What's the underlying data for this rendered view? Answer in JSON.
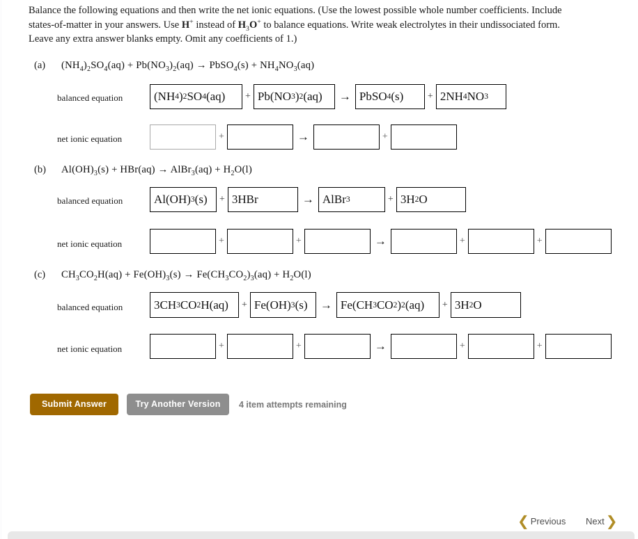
{
  "instructions": {
    "line1_a": "Balance the following equations and then write the net ionic equations. (Use the lowest possible whole number coefficients. Include",
    "line2_a": "states-of-matter in your answers. Use ",
    "line2_h": "H",
    "line2_hsup": "+",
    "line2_b": " instead of ",
    "line2_h3o": "H",
    "line2_h3o_sub": "3",
    "line2_h3o_o": "O",
    "line2_h3o_sup": "+",
    "line2_c": " to balance equations. Write weak electrolytes in their undissociated form.",
    "line3": "Leave any extra answer blanks empty. Omit any coefficients of 1.)"
  },
  "labels": {
    "balanced": "balanced equation",
    "net_ionic": "net ionic equation",
    "plus": "+",
    "arrow": "→"
  },
  "problems": [
    {
      "marker": "(a)",
      "equation_html": "(NH<sub>4</sub>)<sub>2</sub>SO<sub>4</sub>(aq) + Pb(NO<sub>3</sub>)<sub>2</sub>(aq) → PbSO<sub>4</sub>(s) + NH<sub>4</sub>NO<sub>3</sub>(aq)",
      "balanced": {
        "reactants": [
          "(NH<sub>4</sub>)<sub>2</sub>SO<sub>4</sub>(aq)",
          "Pb(NO<sub>3</sub>)<sub>2</sub>(aq)"
        ],
        "products": [
          "PbSO<sub>4</sub>(s)",
          "2NH<sub>4</sub>NO<sub>3</sub>"
        ]
      },
      "net_ionic": {
        "reactants": [
          "",
          ""
        ],
        "products": [
          "",
          ""
        ]
      }
    },
    {
      "marker": "(b)",
      "equation_html": "Al(OH)<sub>3</sub>(s) + HBr(aq) → AlBr<sub>3</sub>(aq) + H<sub>2</sub>O(l)",
      "balanced": {
        "reactants": [
          "Al(OH)<sub>3</sub>(s)",
          "3HBr"
        ],
        "products": [
          "AlBr<sub>3</sub>",
          "3H<sub>2</sub>O"
        ]
      },
      "net_ionic": {
        "reactants": [
          "",
          "",
          ""
        ],
        "products": [
          "",
          "",
          ""
        ]
      }
    },
    {
      "marker": "(c)",
      "equation_html": "CH<sub>3</sub>CO<sub>2</sub>H(aq) + Fe(OH)<sub>3</sub>(s) → Fe(CH<sub>3</sub>CO<sub>2</sub>)<sub>3</sub>(aq) + H<sub>2</sub>O(l)",
      "balanced": {
        "reactants": [
          "3CH<sub>3</sub>CO<sub>2</sub>H(aq)",
          "Fe(OH)<sub>3</sub>(s)"
        ],
        "products": [
          "Fe(CH<sub>3</sub>CO<sub>2</sub>)<sub>2</sub>(aq)",
          "3H<sub>2</sub>O"
        ]
      },
      "net_ionic": {
        "reactants": [
          "",
          "",
          ""
        ],
        "products": [
          "",
          "",
          ""
        ]
      }
    }
  ],
  "actions": {
    "submit_label": "Submit Answer",
    "try_another_label": "Try Another Version",
    "attempts_text": "4 item attempts remaining",
    "submit_color": "#a06800",
    "try_another_color": "#8e8e8e"
  },
  "footer": {
    "previous_label": "Previous",
    "next_label": "Next",
    "prev_icon": "❮",
    "next_icon": "❯",
    "chevron_color": "#b08d26"
  }
}
